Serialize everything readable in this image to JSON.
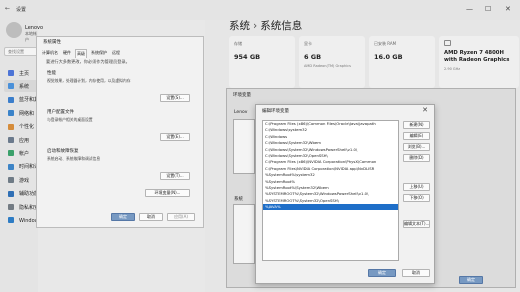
{
  "window": {
    "title": "设置"
  },
  "user": {
    "name": "Lenovo",
    "account": "本地帐户"
  },
  "sidebar": {
    "search_placeholder": "查找设置",
    "items": [
      {
        "label": "主页",
        "color": "#4d74d6"
      },
      {
        "label": "系统",
        "color": "#4a90d9"
      },
      {
        "label": "蓝牙和其他设备",
        "color": "#3b7ecb"
      },
      {
        "label": "网络和 Internet",
        "color": "#3a83c9"
      },
      {
        "label": "个性化",
        "color": "#d58c3b"
      },
      {
        "label": "应用",
        "color": "#6b7a8c"
      },
      {
        "label": "帐户",
        "color": "#3aa06a"
      },
      {
        "label": "时间和语言",
        "color": "#3d84c6"
      },
      {
        "label": "游戏",
        "color": "#6f7b86"
      },
      {
        "label": "辅助功能",
        "color": "#2f6fb5"
      },
      {
        "label": "隐私和安全性",
        "color": "#737b83"
      },
      {
        "label": "Windows 更新",
        "color": "#2e7cc4"
      }
    ]
  },
  "breadcrumb": {
    "parent": "系统",
    "separator": "›",
    "current": "系统信息"
  },
  "cards": [
    {
      "label": "存储",
      "value": "954 GB",
      "sub": ""
    },
    {
      "label": "显卡",
      "value": "6 GB",
      "sub": "AMD Radeon(TM) Graphics"
    },
    {
      "label": "已安装 RAM",
      "value": "16.0 GB",
      "sub": ""
    },
    {
      "label": "",
      "value": "AMD Ryzen 7 4800H with Radeon Graphics",
      "sub": "2.90 GHz"
    }
  ],
  "sysprop": {
    "title": "系统属性",
    "tabs": [
      "计算机名",
      "硬件",
      "高级",
      "系统保护",
      "远程"
    ],
    "note": "要进行大多数更改，你必须作为管理员登录。",
    "perf_title": "性能",
    "perf_desc": "视觉效果，处理器计划，内存使用，以及虚拟内存",
    "profile_title": "用户配置文件",
    "profile_desc": "与登录帐户相关的桌面设置",
    "startup_title": "启动和故障恢复",
    "startup_desc": "系统启动、系统故障和调试信息",
    "settings_btn": "设置(S)...",
    "profile_btn": "设置(E)...",
    "startup_btn": "设置(T)...",
    "env_btn": "环境变量(N)...",
    "ok": "确定",
    "cancel": "取消",
    "apply": "应用(A)"
  },
  "envvar": {
    "title": "环境变量",
    "user_label": "Lenov",
    "sys_label": "系统",
    "ok": "确定"
  },
  "editpath": {
    "title": "编辑环境变量",
    "close": "✕",
    "paths": [
      "C:\\Program Files (x86)\\Common Files\\Oracle\\Java\\javapath",
      "C:\\Windows\\system32",
      "C:\\Windows",
      "C:\\Windows\\System32\\Wbem",
      "C:\\Windows\\System32\\WindowsPowerShell\\v1.0\\",
      "C:\\Windows\\System32\\OpenSSH\\",
      "C:\\Program Files (x86)\\NVIDIA Corporation\\PhysX\\Common",
      "C:\\Program Files\\NVIDIA Corporation\\NVIDIA app\\NvDLISR",
      "%SystemRoot%\\system32",
      "%SystemRoot%",
      "%SystemRoot%\\System32\\Wbem",
      "%SYSTEMROOT%\\System32\\WindowsPowerShell\\v1.0\\",
      "%SYSTEMROOT%\\System32\\OpenSSH\\",
      "%JAVA%",
      ""
    ],
    "selected_index": 13,
    "buttons": [
      "新建(N)",
      "编辑(E)",
      "浏览(B)...",
      "删除(D)",
      "上移(U)",
      "下移(O)",
      "编辑文本(T)..."
    ],
    "ok": "确定",
    "cancel": "取消"
  }
}
